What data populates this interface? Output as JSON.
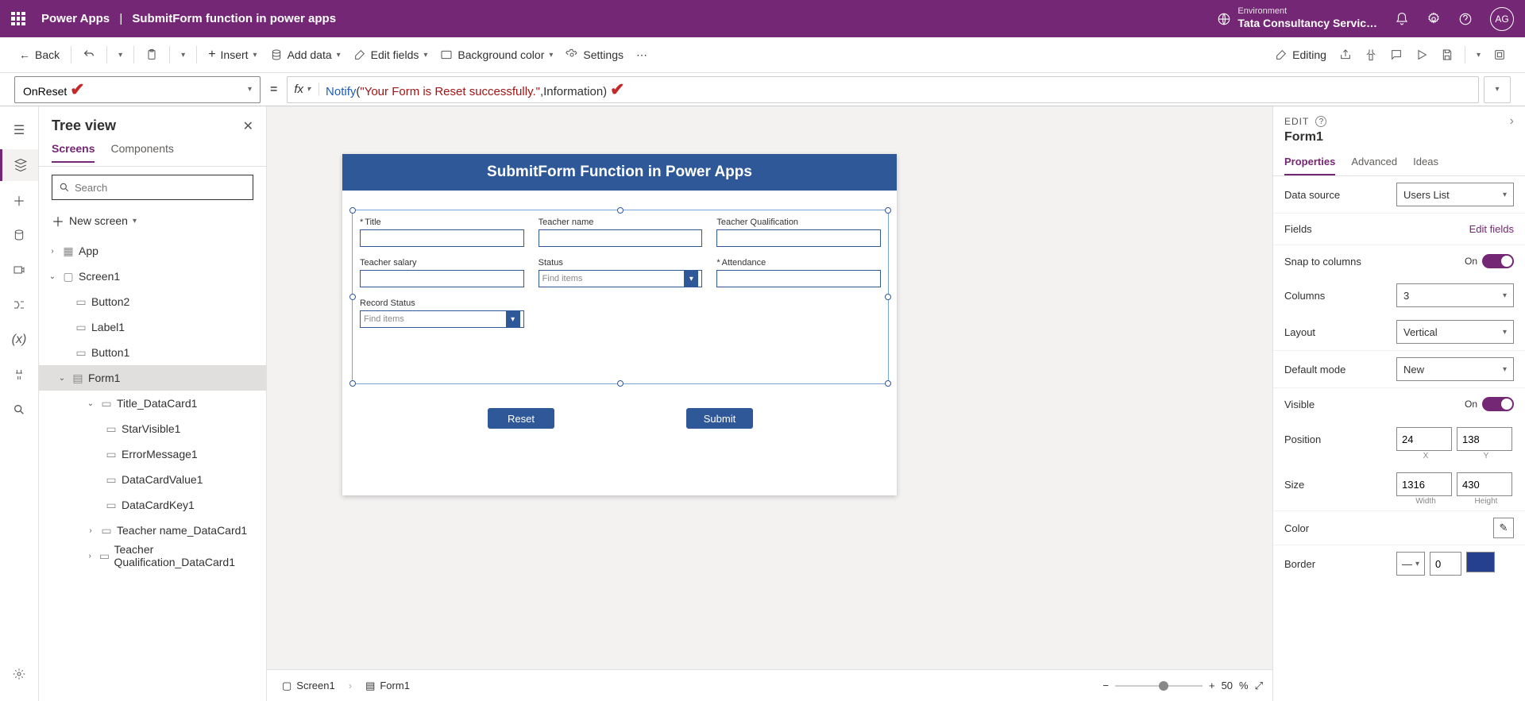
{
  "titlebar": {
    "app": "Power Apps",
    "separator": "|",
    "filename": "SubmitForm function in power apps",
    "env_label": "Environment",
    "env_value": "Tata Consultancy Servic…",
    "avatar": "AG"
  },
  "cmdbar": {
    "back": "Back",
    "insert": "Insert",
    "add_data": "Add data",
    "edit_fields": "Edit fields",
    "bg_color": "Background color",
    "settings": "Settings",
    "editing": "Editing"
  },
  "fx": {
    "property": "OnReset",
    "fn": "Notify",
    "open": "(",
    "str": "\"Your Form is Reset successfully.\"",
    "comma": ",",
    "arg": "Information",
    "close": ")"
  },
  "tree": {
    "title": "Tree view",
    "tabs": {
      "screens": "Screens",
      "components": "Components"
    },
    "search_ph": "Search",
    "new_screen": "New screen",
    "items": {
      "app": "App",
      "screen1": "Screen1",
      "button2": "Button2",
      "label1": "Label1",
      "button1": "Button1",
      "form1": "Form1",
      "title_dc": "Title_DataCard1",
      "starvisible": "StarVisible1",
      "errmsg": "ErrorMessage1",
      "dcval": "DataCardValue1",
      "dckey": "DataCardKey1",
      "tname_dc": "Teacher name_DataCard1",
      "tqual_dc": "Teacher Qualification_DataCard1"
    }
  },
  "canvas": {
    "header": "SubmitForm Function in Power Apps",
    "fields": {
      "title": "Title",
      "tname": "Teacher name",
      "tqual": "Teacher Qualification",
      "tsal": "Teacher salary",
      "status": "Status",
      "att": "Attendance",
      "rec": "Record Status",
      "find_items": "Find items"
    },
    "reset_btn": "Reset",
    "submit_btn": "Submit"
  },
  "footer": {
    "screen": "Screen1",
    "form": "Form1",
    "zoom": "50",
    "pct": "%"
  },
  "props": {
    "edit": "EDIT",
    "elname": "Form1",
    "tabs": {
      "properties": "Properties",
      "advanced": "Advanced",
      "ideas": "Ideas"
    },
    "data_source": "Data source",
    "data_source_val": "Users List",
    "fields": "Fields",
    "edit_fields": "Edit fields",
    "snap": "Snap to columns",
    "on": "On",
    "columns": "Columns",
    "columns_val": "3",
    "layout": "Layout",
    "layout_val": "Vertical",
    "default_mode": "Default mode",
    "default_mode_val": "New",
    "visible": "Visible",
    "position": "Position",
    "pos_x": "24",
    "pos_y": "138",
    "x": "X",
    "y": "Y",
    "size": "Size",
    "size_w": "1316",
    "size_h": "430",
    "w": "Width",
    "h": "Height",
    "color": "Color",
    "border": "Border",
    "border_val": "0"
  }
}
